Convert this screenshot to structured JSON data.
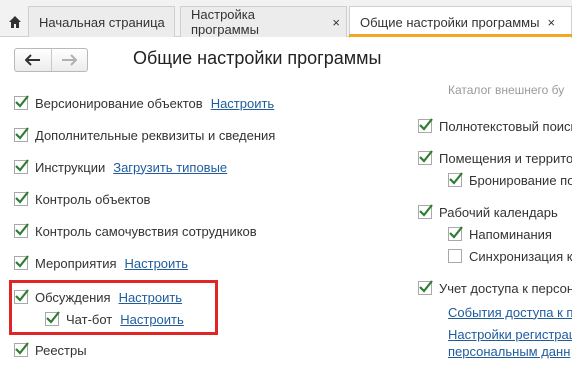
{
  "tabs": {
    "home_label": "Начальная страница",
    "settings_label": "Настройка программы",
    "general_label": "Общие настройки программы"
  },
  "close_glyph": "×",
  "page_title": "Общие настройки программы",
  "accent_color": "#f5a623",
  "highlight_color": "#e02525",
  "left": {
    "versioning": {
      "label": "Версионирование объектов",
      "link": "Настроить"
    },
    "additional_props": {
      "label": "Дополнительные реквизиты и сведения"
    },
    "instructions": {
      "label": "Инструкции",
      "link": "Загрузить типовые"
    },
    "object_control": {
      "label": "Контроль объектов"
    },
    "wellbeing": {
      "label": "Контроль самочувствия сотрудников"
    },
    "events": {
      "label": "Мероприятия",
      "link": "Настроить"
    },
    "discussions": {
      "label": "Обсуждения",
      "link": "Настроить"
    },
    "chatbot": {
      "label": "Чат-бот",
      "link": "Настроить"
    },
    "registers": {
      "label": "Реестры"
    }
  },
  "right": {
    "catalog_text": "Каталог внешнего бу",
    "fulltext": {
      "label": "Полнотекстовый поиск"
    },
    "rooms": {
      "label": "Помещения и террито"
    },
    "booking": {
      "label": "Бронирование по"
    },
    "calendar": {
      "label": "Рабочий календарь"
    },
    "reminders": {
      "label": "Напоминания"
    },
    "sync": {
      "label": "Синхронизация к"
    },
    "access": {
      "label": "Учет доступа к персон"
    },
    "access_events_link": "События доступа к п",
    "reg_settings_link": "Настройки регистрац",
    "personal_data_link": "персональным данн"
  }
}
